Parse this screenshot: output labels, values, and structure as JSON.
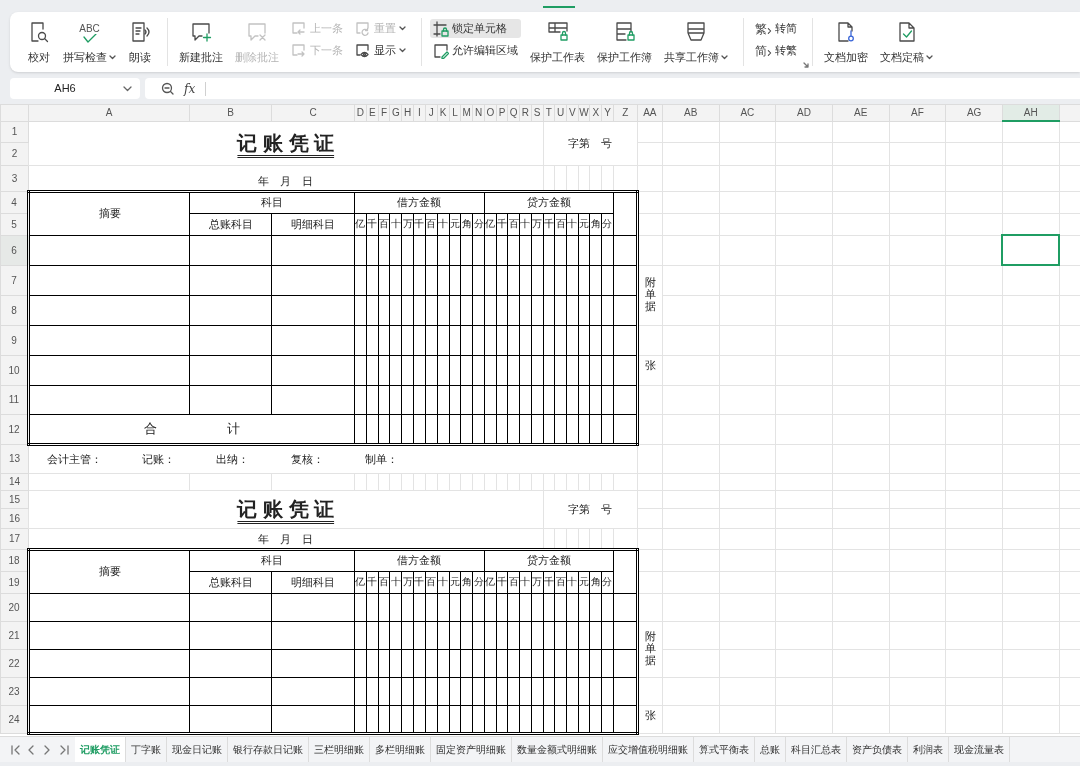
{
  "ribbon": {
    "groups": [
      {
        "items": [
          {
            "label": "校对",
            "kind": "large",
            "disabled": false,
            "pressed": false,
            "dropdown": false
          },
          {
            "label": "拼写检查",
            "kind": "large",
            "glyph": "ABC",
            "disabled": false,
            "pressed": false,
            "dropdown": true
          },
          {
            "label": "朗读",
            "kind": "large",
            "disabled": false,
            "pressed": false,
            "dropdown": false
          }
        ]
      },
      {
        "items": [
          {
            "label": "新建批注",
            "kind": "large",
            "disabled": false,
            "pressed": false,
            "dropdown": false
          },
          {
            "label": "删除批注",
            "kind": "large",
            "disabled": true,
            "pressed": false,
            "dropdown": false
          },
          {
            "label": "上一条",
            "kind": "small",
            "disabled": true,
            "pressed": false,
            "dropdown": false
          },
          {
            "label": "下一条",
            "kind": "small",
            "disabled": true,
            "pressed": false,
            "dropdown": false
          },
          {
            "label": "重置",
            "kind": "small",
            "disabled": true,
            "pressed": false,
            "dropdown": true
          },
          {
            "label": "显示",
            "kind": "small",
            "disabled": false,
            "pressed": false,
            "dropdown": true
          }
        ]
      },
      {
        "items": [
          {
            "label": "锁定单元格",
            "kind": "small",
            "disabled": false,
            "pressed": true,
            "dropdown": false
          },
          {
            "label": "允许编辑区域",
            "kind": "small",
            "disabled": false,
            "pressed": false,
            "dropdown": false
          },
          {
            "label": "保护工作表",
            "kind": "large",
            "disabled": false,
            "pressed": false,
            "dropdown": false
          },
          {
            "label": "保护工作簿",
            "kind": "large",
            "disabled": false,
            "pressed": false,
            "dropdown": false
          },
          {
            "label": "共享工作簿",
            "kind": "large",
            "disabled": false,
            "pressed": false,
            "dropdown": true
          }
        ]
      },
      {
        "launcher": true,
        "items": [
          {
            "label": "转简",
            "kind": "small",
            "glyph": "繁",
            "disabled": false,
            "pressed": false,
            "dropdown": false
          },
          {
            "label": "转繁",
            "kind": "small",
            "glyph": "简",
            "disabled": false,
            "pressed": false,
            "dropdown": false
          }
        ]
      },
      {
        "items": [
          {
            "label": "文档加密",
            "kind": "large",
            "disabled": false,
            "pressed": false,
            "dropdown": false
          },
          {
            "label": "文档定稿",
            "kind": "large",
            "disabled": false,
            "pressed": false,
            "dropdown": true
          }
        ]
      }
    ]
  },
  "formula_bar": {
    "name_box": "AH6",
    "function_label": "fx"
  },
  "sheet": {
    "columns": [
      {
        "label": "A",
        "selected": false
      },
      {
        "label": "B",
        "selected": false
      },
      {
        "label": "C",
        "selected": false
      },
      {
        "label": "D",
        "selected": false
      },
      {
        "label": "E",
        "selected": false
      },
      {
        "label": "F",
        "selected": false
      },
      {
        "label": "G",
        "selected": false
      },
      {
        "label": "H",
        "selected": false
      },
      {
        "label": "I",
        "selected": false
      },
      {
        "label": "J",
        "selected": false
      },
      {
        "label": "K",
        "selected": false
      },
      {
        "label": "L",
        "selected": false
      },
      {
        "label": "M",
        "selected": false
      },
      {
        "label": "N",
        "selected": false
      },
      {
        "label": "O",
        "selected": false
      },
      {
        "label": "P",
        "selected": false
      },
      {
        "label": "Q",
        "selected": false
      },
      {
        "label": "R",
        "selected": false
      },
      {
        "label": "S",
        "selected": false
      },
      {
        "label": "T",
        "selected": false
      },
      {
        "label": "U",
        "selected": false
      },
      {
        "label": "V",
        "selected": false
      },
      {
        "label": "W",
        "selected": false
      },
      {
        "label": "X",
        "selected": false
      },
      {
        "label": "Y",
        "selected": false
      },
      {
        "label": "Z",
        "selected": false
      },
      {
        "label": "AA",
        "selected": false
      },
      {
        "label": "AB",
        "selected": false
      },
      {
        "label": "AC",
        "selected": false
      },
      {
        "label": "AD",
        "selected": false
      },
      {
        "label": "AE",
        "selected": false
      },
      {
        "label": "AF",
        "selected": false
      },
      {
        "label": "AG",
        "selected": false
      },
      {
        "label": "AH",
        "selected": true
      }
    ],
    "rows": [
      {
        "label": "1",
        "selected": false
      },
      {
        "label": "2",
        "selected": false
      },
      {
        "label": "3",
        "selected": false
      },
      {
        "label": "4",
        "selected": false
      },
      {
        "label": "5",
        "selected": false
      },
      {
        "label": "6",
        "selected": true
      },
      {
        "label": "7",
        "selected": false
      },
      {
        "label": "8",
        "selected": false
      },
      {
        "label": "9",
        "selected": false
      },
      {
        "label": "10",
        "selected": false
      },
      {
        "label": "11",
        "selected": false
      },
      {
        "label": "12",
        "selected": false
      },
      {
        "label": "13",
        "selected": false
      },
      {
        "label": "14",
        "selected": false
      },
      {
        "label": "15",
        "selected": false
      },
      {
        "label": "16",
        "selected": false
      },
      {
        "label": "17",
        "selected": false
      },
      {
        "label": "18",
        "selected": false
      },
      {
        "label": "19",
        "selected": false
      },
      {
        "label": "20",
        "selected": false
      },
      {
        "label": "21",
        "selected": false
      },
      {
        "label": "22",
        "selected": false
      },
      {
        "label": "23",
        "selected": false
      },
      {
        "label": "24",
        "selected": false
      }
    ],
    "vouchers": [
      {
        "title": "记 账 凭 证",
        "number_label": "字第　号",
        "date_label": "年　月　日",
        "summary_header": "摘要",
        "account_header": "科目",
        "general_account_header": "总账科目",
        "detail_account_header": "明细科目",
        "debit_header": "借方金额",
        "credit_header": "贷方金额",
        "debit_digits": [
          "亿",
          "千",
          "百",
          "十",
          "万",
          "千",
          "百",
          "十",
          "元",
          "角",
          "分"
        ],
        "credit_digits": [
          "亿",
          "千",
          "百",
          "十",
          "万",
          "千",
          "百",
          "十",
          "元",
          "角",
          "分"
        ],
        "attachment_label": "附单据",
        "count_label": "张",
        "total_labels": [
          "合",
          "计"
        ],
        "signatures": [
          "会计主管：",
          "记账：",
          "出纳：",
          "复核：",
          "制单："
        ]
      },
      {
        "title": "记 账 凭 证",
        "number_label": "字第　号",
        "date_label": "年　月　日",
        "summary_header": "摘要",
        "account_header": "科目",
        "general_account_header": "总账科目",
        "detail_account_header": "明细科目",
        "debit_header": "借方金额",
        "credit_header": "贷方金额",
        "debit_digits": [
          "亿",
          "千",
          "百",
          "十",
          "万",
          "千",
          "百",
          "十",
          "元",
          "角",
          "分"
        ],
        "credit_digits": [
          "亿",
          "千",
          "百",
          "十",
          "万",
          "千",
          "百",
          "十",
          "元",
          "角",
          "分"
        ],
        "attachment_label": "附单据",
        "count_label": "张"
      }
    ]
  },
  "sheet_tabs": [
    {
      "label": "记账凭证",
      "selected": true
    },
    {
      "label": "丁字账",
      "selected": false
    },
    {
      "label": "现金日记账",
      "selected": false
    },
    {
      "label": "银行存款日记账",
      "selected": false
    },
    {
      "label": "三栏明细账",
      "selected": false
    },
    {
      "label": "多栏明细账",
      "selected": false
    },
    {
      "label": "固定资产明细账",
      "selected": false
    },
    {
      "label": "数量金额式明细账",
      "selected": false
    },
    {
      "label": "应交增值税明细账",
      "selected": false
    },
    {
      "label": "算式平衡表",
      "selected": false
    },
    {
      "label": "总账",
      "selected": false
    },
    {
      "label": "科目汇总表",
      "selected": false
    },
    {
      "label": "资产负债表",
      "selected": false
    },
    {
      "label": "利润表",
      "selected": false
    },
    {
      "label": "现金流量表",
      "selected": false
    }
  ]
}
